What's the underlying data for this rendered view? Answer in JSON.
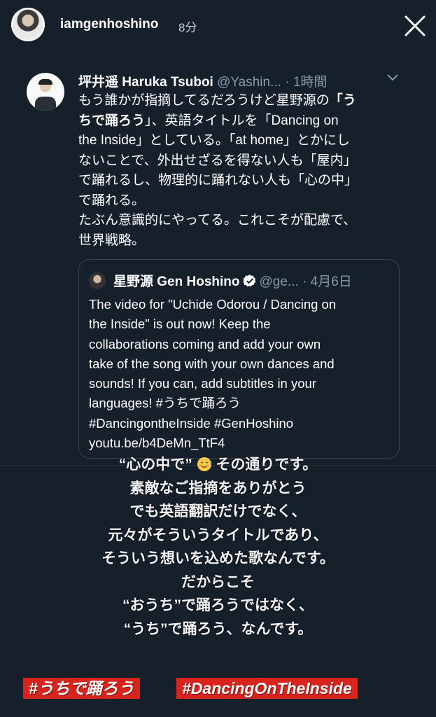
{
  "story": {
    "username": "iamgenhoshino",
    "time": "8分"
  },
  "tweet": {
    "name": "坪井遥 Haruka Tsuboi",
    "handle": "@Yashin...",
    "time": "· 1時間",
    "lines": [
      [
        "もう誰かが指摘してるだろうけど星野源の",
        "「う"
      ],
      [
        "ちで踊ろう",
        "」、英語タイトルを「Dancing on"
      ],
      [
        "the Inside」としている。「at home」とかにし",
        ""
      ],
      [
        "ないことで、外出せざるを得ない人も「屋内」",
        ""
      ],
      [
        "で踊れるし、物理的に踊れない人も「心の中」",
        ""
      ],
      [
        "で踊れる。",
        ""
      ],
      [
        "たぶん意識的にやってる。これこそが配慮で、",
        ""
      ],
      [
        "世界戦略。",
        ""
      ]
    ]
  },
  "quote": {
    "name": "星野源 Gen Hoshino",
    "handle": "@ge...",
    "time": "· 4月6日",
    "lines": [
      "The video for \"Uchide Odorou / Dancing on",
      "the Inside\" is out now! Keep the",
      "collaborations coming and add your own",
      "take of the song with your own dances and",
      "sounds! If you can, add subtitles in your",
      "languages! #うちで踊ろう",
      "#DancingontheInside #GenHoshino",
      "youtu.be/b4DeMn_TtF4"
    ]
  },
  "caption": {
    "first_a": "“心の中で”",
    "first_b": "その通りです。",
    "lines": [
      "素敵なご指摘をありがとう",
      "でも英語翻訳だけでなく、",
      "元々がそういうタイトルであり、",
      "そういう想いを込めた歌なんです。",
      "だからこそ",
      "“おうち”で踊ろうではなく、",
      "“うち”で踊ろう、なんです。"
    ]
  },
  "hashtags": [
    "#うちで踊ろう",
    "#DancingOnTheInside"
  ],
  "colors": {
    "background": "#15202b",
    "handle": "#8899a6",
    "border": "#38444d",
    "hashtag_bg": "#d9241e",
    "verified": "#ffffff"
  },
  "icons": {
    "close": "close-icon",
    "chevron": "chevron-down-icon",
    "verified": "verified-badge-icon",
    "emoji": "smiling-face-emoji"
  }
}
